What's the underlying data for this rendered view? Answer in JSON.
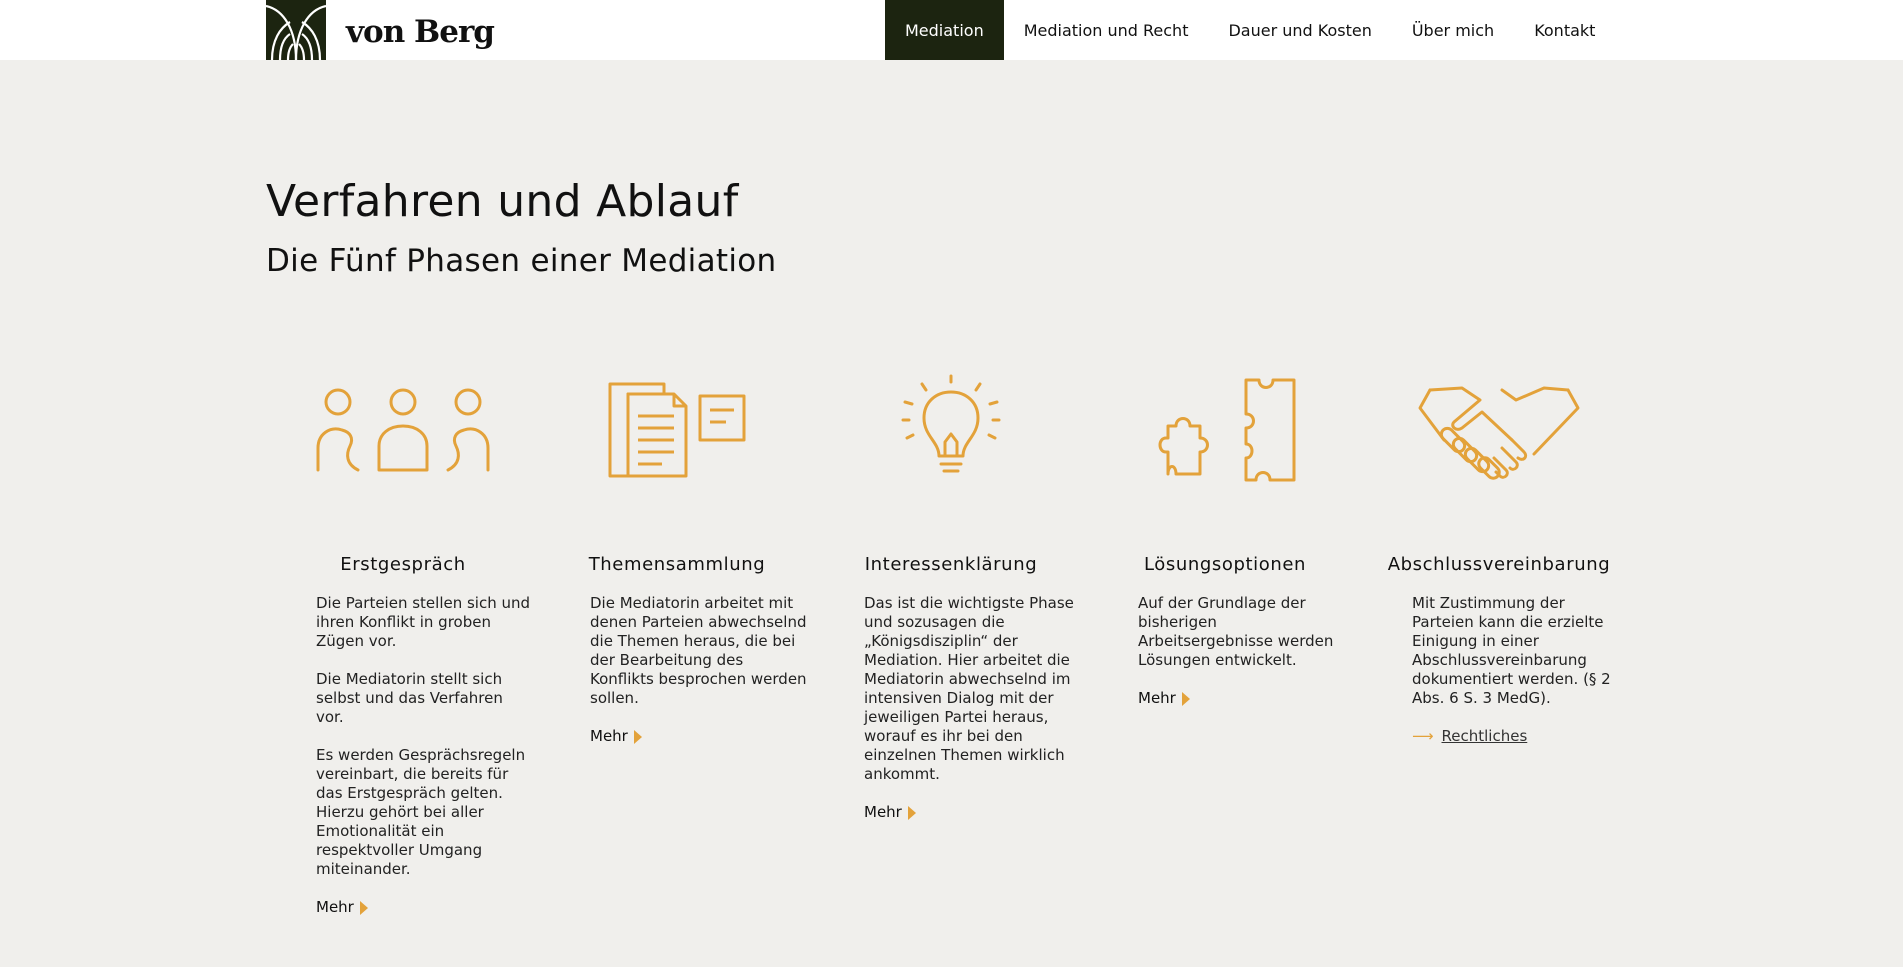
{
  "brand": {
    "name": "von Berg",
    "dark_color": "#1c2410",
    "accent_color": "#e3a23a",
    "logo_icon": "arch-logo-icon"
  },
  "nav": {
    "items": [
      {
        "label": "Mediation",
        "active": true
      },
      {
        "label": "Mediation und Recht",
        "active": false
      },
      {
        "label": "Dauer und Kosten",
        "active": false
      },
      {
        "label": "Über mich",
        "active": false
      },
      {
        "label": "Kontakt",
        "active": false
      }
    ]
  },
  "page": {
    "title": "Verfahren und Ablauf",
    "subtitle": "Die Fünf Phasen einer Mediation"
  },
  "phases": [
    {
      "icon": "people-icon",
      "title": "Erstgespräch",
      "paragraphs": [
        "Die Parteien stellen sich und ihren Konflikt in groben Zügen vor.",
        "Die Mediatorin stellt sich selbst und das Verfahren vor.",
        "Es werden Gesprächsregeln vereinbart, die bereits für das Erstgespräch gelten. Hierzu gehört bei aller Emotionalität ein respektvoller Umgang miteinander."
      ],
      "link": "Mehr"
    },
    {
      "icon": "documents-icon",
      "title": "Themensammlung",
      "paragraphs": [
        "Die Mediatorin arbeitet mit denen Parteien abwechselnd die Themen heraus, die bei der Bearbeitung des Konflikts besprochen werden sollen."
      ],
      "link": "Mehr"
    },
    {
      "icon": "lightbulb-icon",
      "title": "Interessenklärung",
      "paragraphs": [
        "Das ist die wichtigste Phase und sozusagen die „Königsdisziplin“ der Mediation. Hier arbeitet die Mediatorin abwechselnd im intensiven Dialog mit der jeweiligen Partei heraus, worauf es ihr bei den einzelnen Themen wirklich ankommt."
      ],
      "link": "Mehr"
    },
    {
      "icon": "puzzle-icon",
      "title": "Lösungsoptionen",
      "paragraphs": [
        "Auf der Grundlage der bisherigen Arbeitsergebnisse werden Lösungen entwickelt."
      ],
      "link": "Mehr"
    },
    {
      "icon": "handshake-icon",
      "title": "Abschlussvereinbarung",
      "paragraphs": [
        "Mit Zustimmung der Parteien kann die erzielte Einigung in einer Abschlussvereinbarung dokumentiert werden. (§ 2 Abs. 6 S. 3 MedG)."
      ],
      "link": "Rechtliches"
    }
  ]
}
